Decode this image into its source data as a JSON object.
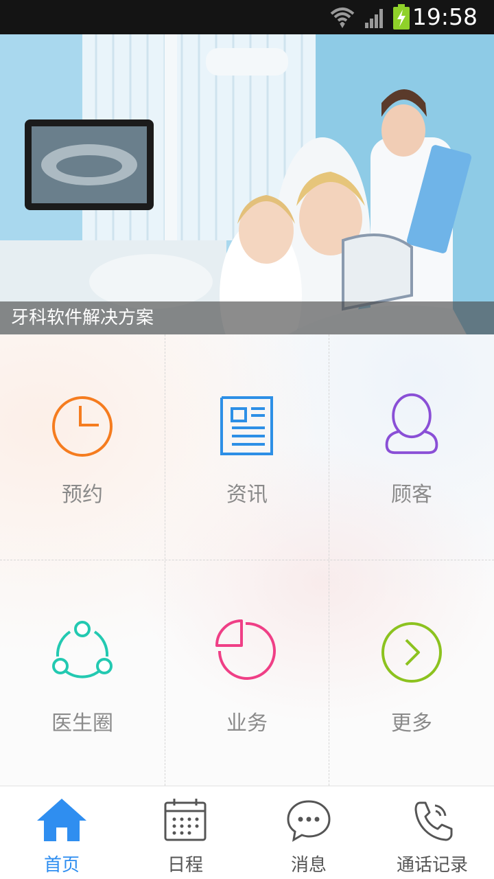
{
  "status_bar": {
    "time": "19:58",
    "icons": [
      "wifi-icon",
      "signal-icon",
      "battery-charging-icon"
    ]
  },
  "banner": {
    "caption": "牙科软件解决方案"
  },
  "grid": {
    "items": [
      {
        "label": "预约",
        "icon": "clock-icon",
        "color": "#f57c1f"
      },
      {
        "label": "资讯",
        "icon": "news-icon",
        "color": "#2d8fe6"
      },
      {
        "label": "顾客",
        "icon": "person-icon",
        "color": "#8a4fd6"
      },
      {
        "label": "医生圈",
        "icon": "share-circle-icon",
        "color": "#23c9b1"
      },
      {
        "label": "业务",
        "icon": "pie-chart-icon",
        "color": "#ef3f86"
      },
      {
        "label": "更多",
        "icon": "chevron-right-circle-icon",
        "color": "#8cc21f"
      }
    ]
  },
  "tab_bar": {
    "active_color": "#2f8ef0",
    "tabs": [
      {
        "label": "首页",
        "icon": "home-icon",
        "active": true
      },
      {
        "label": "日程",
        "icon": "calendar-icon",
        "active": false
      },
      {
        "label": "消息",
        "icon": "chat-bubble-icon",
        "active": false
      },
      {
        "label": "通话记录",
        "icon": "phone-icon",
        "active": false
      }
    ]
  }
}
